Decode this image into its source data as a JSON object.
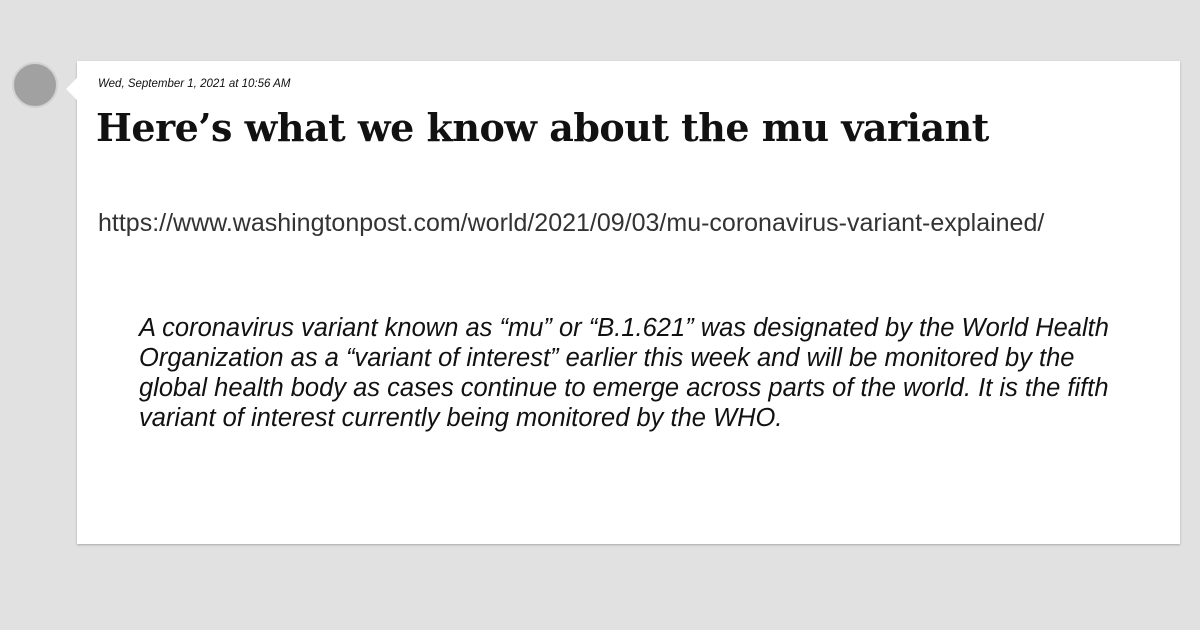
{
  "post": {
    "date": "Wed, September 1, 2021 at 10:56 AM",
    "title": "Here’s what we know about the mu variant",
    "url": "https://www.washingtonpost.com/world/2021/09/03/mu-coronavirus-variant-explained/",
    "quote": "A coronavirus variant known as “mu” or “B.1.621” was designated by the World Health Organization as a “variant of interest” earlier this week and will be monitored by the global health body as cases continue to emerge across parts of the world. It is the fifth variant of interest currently being monitored by the WHO."
  }
}
